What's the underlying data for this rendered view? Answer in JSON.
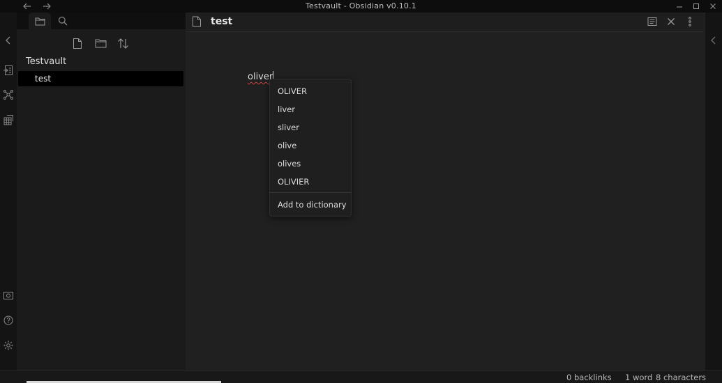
{
  "window": {
    "title": "Testvault - Obsidian v0.10.1"
  },
  "sidebar": {
    "vault_name": "Testvault",
    "files": [
      {
        "name": "test"
      }
    ]
  },
  "editor": {
    "note_title": "test",
    "content_word": "oliver"
  },
  "context_menu": {
    "suggestions": [
      "OLIVER",
      "liver",
      "sliver",
      "olive",
      "olives",
      "OLIVIER"
    ],
    "add_to_dictionary": "Add to dictionary"
  },
  "status_bar": {
    "backlinks": "0 backlinks",
    "word_count": "1 word",
    "char_count": "8 characters"
  },
  "icons": {
    "back": "arrow-left-icon",
    "forward": "arrow-right-icon",
    "minimize": "minimize-icon",
    "maximize": "maximize-icon",
    "close": "close-icon"
  }
}
